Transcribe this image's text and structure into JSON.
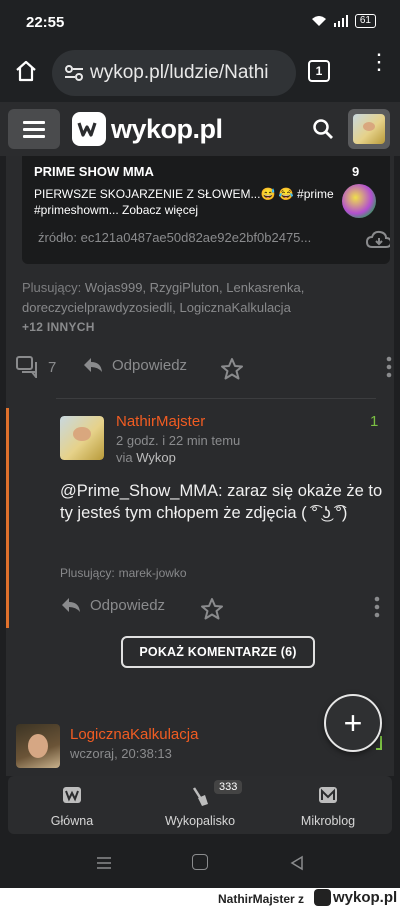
{
  "status": {
    "time": "22:55",
    "battery": "61"
  },
  "browser": {
    "url": "wykop.pl/ludzie/Nathi",
    "tabs_count": "1"
  },
  "site": {
    "logo_text": "wykop.pl"
  },
  "embed": {
    "title": "PRIME SHOW MMA",
    "count": "9",
    "text": "PIERWSZE SKOJARZENIE Z SŁOWEM...😅 😂 #prime #primeshowm...  Zobacz więcej",
    "source": "źródło: ec121a0487ae50d82ae92e2bf0b2475..."
  },
  "post": {
    "plus_label": "Plusujący:",
    "plus_names": "Wojas999, RzygiPluton, Lenkasrenka, doreczycielprawdyzosiedli, LogicznaKalkulacja",
    "plus_more": "+12 INNYCH",
    "comments": "7",
    "reply_label": "Odpowiedz"
  },
  "reply": {
    "author": "NathirMajster",
    "time": "2 godz. i 22 min temu",
    "via_prefix": "via",
    "via_app": "Wykop",
    "votes": "1",
    "body": "@Prime_Show_MMA: zaraz się okaże że to ty jesteś tym chłopem że zdjęcia ( ͡° ͜ʖ ͡°)",
    "plus_label": "Plusujący:",
    "plus_names": "marek-jowko",
    "reply_label": "Odpowiedz"
  },
  "show_comments": "POKAŻ KOMENTARZE (6)",
  "next_post": {
    "author": "LogicznaKalkulacja",
    "time": "wczoraj, 20:38:13"
  },
  "fab": "+",
  "nav": [
    {
      "label": "Główna"
    },
    {
      "label": "Wykopalisko",
      "badge": "333"
    },
    {
      "label": "Mikroblog"
    }
  ],
  "watermark": {
    "user": "NathirMajster",
    "sep": "z",
    "logo": "wykop.pl"
  },
  "colors": {
    "accent": "#f15c22",
    "positive": "#7bc043",
    "reply_bar": "#e0712c"
  }
}
